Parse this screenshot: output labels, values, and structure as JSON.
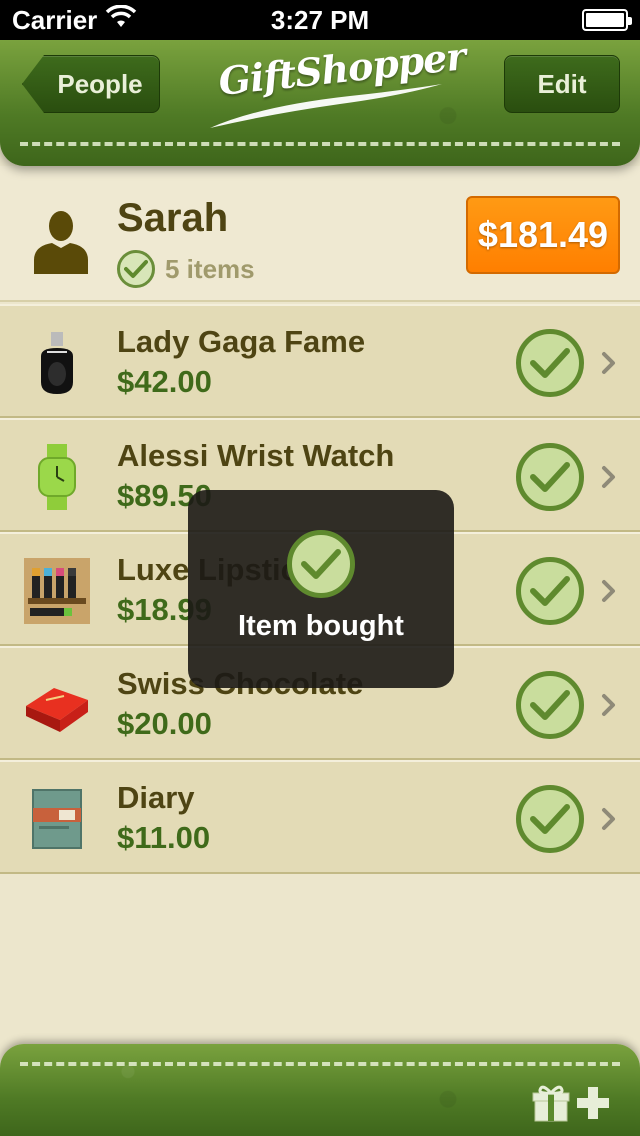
{
  "status_bar": {
    "carrier": "Carrier",
    "time": "3:27 PM",
    "battery_level": 1.0
  },
  "nav": {
    "back_label": "People",
    "logo_text": "GiftShopper",
    "edit_label": "Edit"
  },
  "person": {
    "name": "Sarah",
    "item_count": "5 items",
    "total": "$181.49"
  },
  "gifts": [
    {
      "name": "Lady Gaga Fame",
      "price": "$42.00",
      "icon": "perfume-bottle-icon",
      "bought": true
    },
    {
      "name": "Alessi Wrist Watch",
      "price": "$89.50",
      "icon": "wrist-watch-icon",
      "bought": true
    },
    {
      "name": "Luxe Lipstick",
      "price": "$18.99",
      "icon": "lipstick-icon",
      "bought": true
    },
    {
      "name": "Swiss Chocolate",
      "price": "$20.00",
      "icon": "chocolate-box-icon",
      "bought": true
    },
    {
      "name": "Diary",
      "price": "$11.00",
      "icon": "diary-book-icon",
      "bought": true
    }
  ],
  "toast": {
    "text": "Item bought"
  },
  "colors": {
    "leather_green": "#5b8a2c",
    "total_badge_orange": "#ff8c00",
    "check_green": "#5f8a2e",
    "row_background": "#e3dbb6",
    "header_background": "#efe9d2"
  }
}
